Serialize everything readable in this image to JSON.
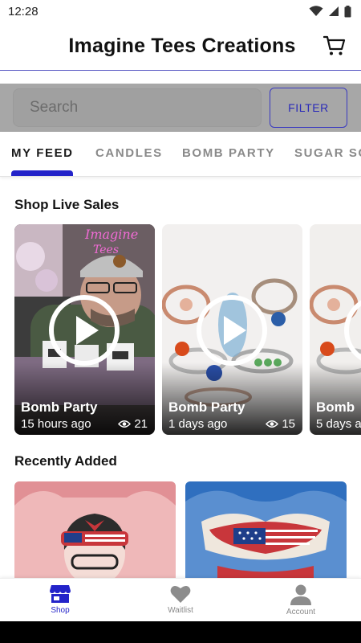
{
  "status_bar": {
    "time": "12:28"
  },
  "header": {
    "title": "Imagine Tees Creations",
    "cart_icon": "cart-icon"
  },
  "search": {
    "placeholder": "Search",
    "filter_label": "FILTER"
  },
  "tabs": [
    {
      "label": "MY FEED",
      "active": true
    },
    {
      "label": "CANDLES",
      "active": false
    },
    {
      "label": "BOMB PARTY",
      "active": false
    },
    {
      "label": "SUGAR SC",
      "active": false
    }
  ],
  "live_sales": {
    "title": "Shop Live Sales",
    "cards": [
      {
        "title": "Bomb Party",
        "time": "15 hours ago",
        "views": "21"
      },
      {
        "title": "Bomb Party",
        "time": "1 days ago",
        "views": "15"
      },
      {
        "title": "Bomb",
        "time": "5 days a",
        "views": ""
      }
    ]
  },
  "recently_added": {
    "title": "Recently Added"
  },
  "bottom_nav": [
    {
      "label": "Shop",
      "icon": "store-icon",
      "active": true
    },
    {
      "label": "Waitlist",
      "icon": "heart-icon",
      "active": false
    },
    {
      "label": "Account",
      "icon": "person-icon",
      "active": false
    }
  ],
  "colors": {
    "accent": "#2323c9",
    "search_overlay": "#a7a7a7"
  }
}
